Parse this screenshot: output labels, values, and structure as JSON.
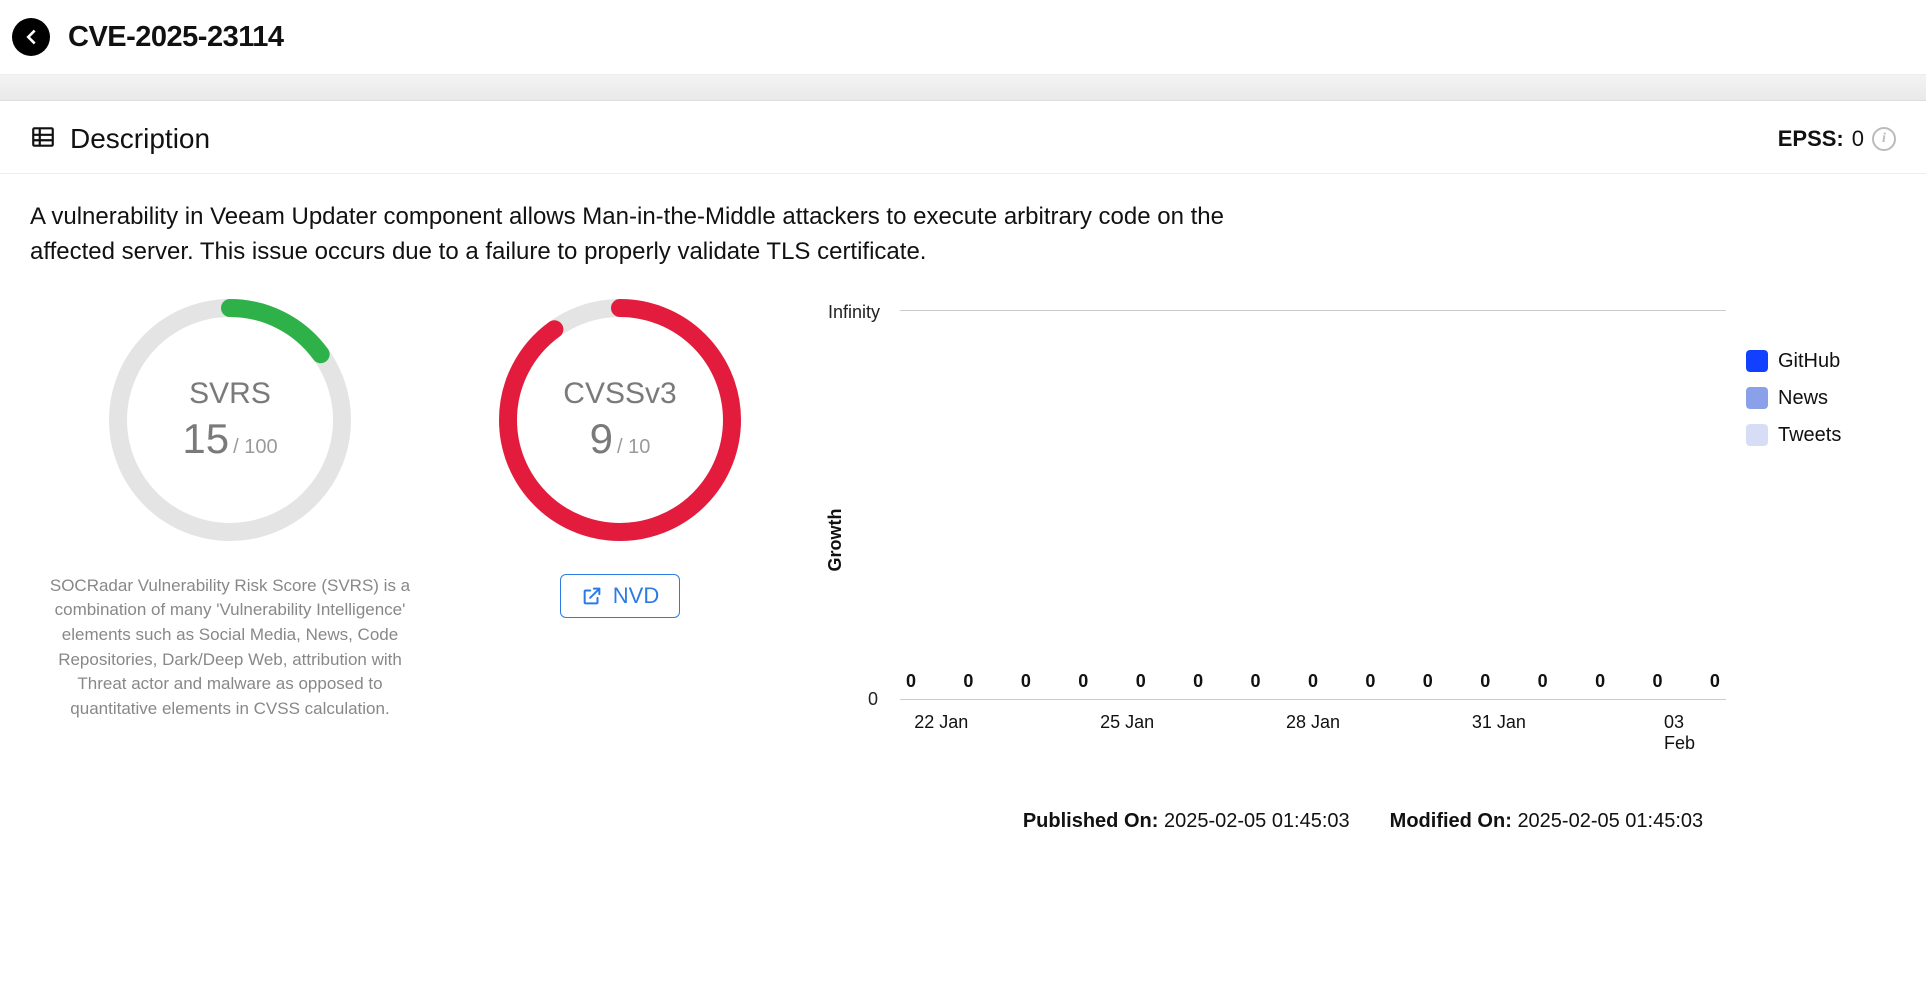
{
  "header": {
    "title": "CVE-2025-23114"
  },
  "section": {
    "title": "Description"
  },
  "epss": {
    "label": "EPSS:",
    "value": "0"
  },
  "description": "A vulnerability in Veeam Updater component allows Man-in-the-Middle attackers to execute arbitrary code on the affected server. This issue occurs due to a failure to properly validate TLS certificate.",
  "svrs": {
    "label": "SVRS",
    "value": "15",
    "max": "/ 100",
    "fraction": 0.15,
    "color": "#2fb14a",
    "explain": "SOCRadar Vulnerability Risk Score (SVRS) is a combination of many 'Vulnerability Intelligence' elements such as Social Media, News, Code Repositories, Dark/Deep Web, attribution with Threat actor and malware as opposed to quantitative elements in CVSS calculation."
  },
  "cvss": {
    "label": "CVSSv3",
    "value": "9",
    "max": "/ 10",
    "fraction": 0.9,
    "color": "#e31b3d",
    "link_label": "NVD"
  },
  "chart_data": {
    "type": "line",
    "ylabel": "Growth",
    "ylim_top": "Infinity",
    "ylim_bottom": "0",
    "x_ticks": [
      "22 Jan",
      "25 Jan",
      "28 Jan",
      "31 Jan",
      "03 Feb"
    ],
    "data_labels": [
      "0",
      "0",
      "0",
      "0",
      "0",
      "0",
      "0",
      "0",
      "0",
      "0",
      "0",
      "0",
      "0",
      "0",
      "0"
    ],
    "series": [
      {
        "name": "GitHub",
        "color": "#1141ff",
        "values": [
          0,
          0,
          0,
          0,
          0,
          0,
          0,
          0,
          0,
          0,
          0,
          0,
          0,
          0,
          0
        ]
      },
      {
        "name": "News",
        "color": "#8aa0e8",
        "values": [
          0,
          0,
          0,
          0,
          0,
          0,
          0,
          0,
          0,
          0,
          0,
          0,
          0,
          0,
          0
        ]
      },
      {
        "name": "Tweets",
        "color": "#d7ddf5",
        "values": [
          0,
          0,
          0,
          0,
          0,
          0,
          0,
          0,
          0,
          0,
          0,
          0,
          0,
          0,
          0
        ]
      }
    ]
  },
  "meta": {
    "published_label": "Published On:",
    "published_value": "2025-02-05 01:45:03",
    "modified_label": "Modified On:",
    "modified_value": "2025-02-05 01:45:03"
  }
}
